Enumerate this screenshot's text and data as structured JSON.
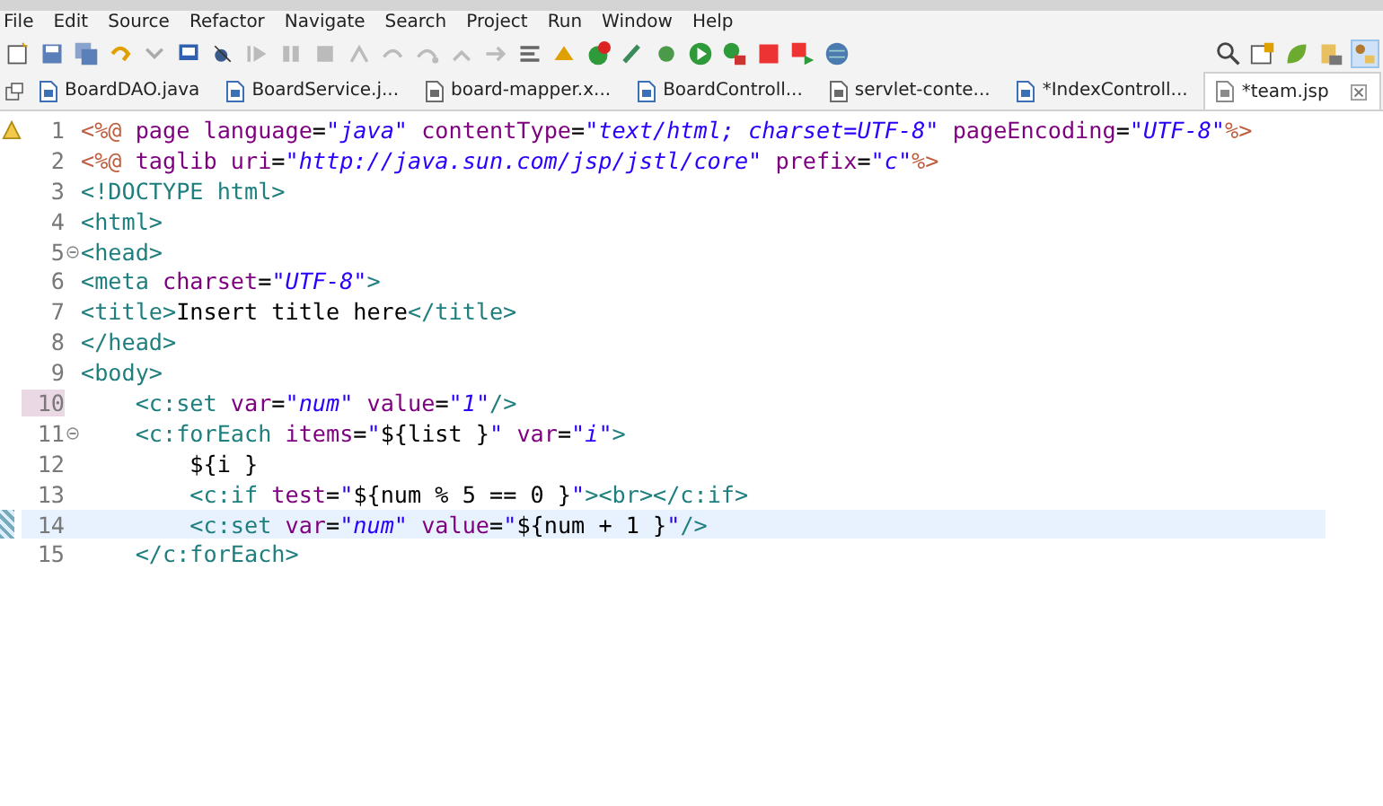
{
  "menu": [
    "File",
    "Edit",
    "Source",
    "Refactor",
    "Navigate",
    "Search",
    "Project",
    "Run",
    "Window",
    "Help"
  ],
  "tabs": [
    {
      "label": "BoardDAO.java",
      "kind": "java",
      "selected": false
    },
    {
      "label": "BoardService.j...",
      "kind": "java",
      "selected": false
    },
    {
      "label": "board-mapper.x...",
      "kind": "xml",
      "selected": false
    },
    {
      "label": "BoardControll...",
      "kind": "java",
      "selected": false
    },
    {
      "label": "servlet-conte...",
      "kind": "xml",
      "selected": false
    },
    {
      "label": "*IndexControll...",
      "kind": "java",
      "selected": false
    },
    {
      "label": "*team.jsp",
      "kind": "jsp",
      "selected": true
    }
  ],
  "lines": [
    {
      "number": "1",
      "marked": false,
      "current": false,
      "foldable": false,
      "tokens": [
        {
          "kind": "dir",
          "text": "<%@"
        },
        {
          "kind": "attr",
          "text": " page language"
        },
        {
          "kind": "eq",
          "text": "="
        },
        {
          "kind": "str",
          "text": "\"java\""
        },
        {
          "kind": "attr",
          "text": " contentType"
        },
        {
          "kind": "eq",
          "text": "="
        },
        {
          "kind": "str",
          "text": "\"text/html; charset=UTF-8\""
        },
        {
          "kind": "attr",
          "text": " pageEncoding"
        },
        {
          "kind": "eq",
          "text": "="
        },
        {
          "kind": "str",
          "text": "\"UTF-8\""
        },
        {
          "kind": "dir",
          "text": "%>"
        }
      ]
    },
    {
      "number": "2",
      "marked": false,
      "current": false,
      "foldable": false,
      "tokens": [
        {
          "kind": "dir",
          "text": "<%@"
        },
        {
          "kind": "attr",
          "text": " taglib uri"
        },
        {
          "kind": "eq",
          "text": "="
        },
        {
          "kind": "str",
          "text": "\"http://java.sun.com/jsp/jstl/core\""
        },
        {
          "kind": "attr",
          "text": " prefix"
        },
        {
          "kind": "eq",
          "text": "="
        },
        {
          "kind": "str",
          "text": "\"c\""
        },
        {
          "kind": "dir",
          "text": "%>"
        }
      ]
    },
    {
      "number": "3",
      "marked": false,
      "current": false,
      "foldable": false,
      "tokens": [
        {
          "kind": "tag",
          "text": "<!DOCTYPE html>"
        }
      ]
    },
    {
      "number": "4",
      "marked": false,
      "current": false,
      "foldable": false,
      "tokens": [
        {
          "kind": "tag",
          "text": "<html>"
        }
      ]
    },
    {
      "number": "5",
      "marked": false,
      "current": false,
      "foldable": true,
      "tokens": [
        {
          "kind": "tag",
          "text": "<head>"
        }
      ]
    },
    {
      "number": "6",
      "marked": false,
      "current": false,
      "foldable": false,
      "tokens": [
        {
          "kind": "tag",
          "text": "<meta"
        },
        {
          "kind": "attr",
          "text": " charset"
        },
        {
          "kind": "eq",
          "text": "="
        },
        {
          "kind": "str",
          "text": "\"UTF-8\""
        },
        {
          "kind": "tag",
          "text": ">"
        }
      ]
    },
    {
      "number": "7",
      "marked": false,
      "current": false,
      "foldable": false,
      "tokens": [
        {
          "kind": "tag",
          "text": "<title>"
        },
        {
          "kind": "text",
          "text": "Insert title here"
        },
        {
          "kind": "tag",
          "text": "</title>"
        }
      ]
    },
    {
      "number": "8",
      "marked": false,
      "current": false,
      "foldable": false,
      "tokens": [
        {
          "kind": "tag",
          "text": "</head>"
        }
      ]
    },
    {
      "number": "9",
      "marked": false,
      "current": false,
      "foldable": false,
      "tokens": [
        {
          "kind": "tag",
          "text": "<body>"
        }
      ],
      "children": [
        {
          "number": "10",
          "marked": true,
          "current": false,
          "foldable": false,
          "tokens": [
            {
              "kind": "tag",
              "text": "<c:set"
            },
            {
              "kind": "attr",
              "text": " var"
            },
            {
              "kind": "eq",
              "text": "="
            },
            {
              "kind": "str",
              "text": "\"num\""
            },
            {
              "kind": "attr",
              "text": " value"
            },
            {
              "kind": "eq",
              "text": "="
            },
            {
              "kind": "str",
              "text": "\"1\""
            },
            {
              "kind": "tag",
              "text": "/>"
            }
          ]
        },
        {
          "number": "11",
          "marked": false,
          "current": false,
          "foldable": true,
          "tokens": [
            {
              "kind": "tag",
              "text": "<c:forEach"
            },
            {
              "kind": "attr",
              "text": " items"
            },
            {
              "kind": "eq",
              "text": "="
            },
            {
              "kind": "str",
              "text": "\""
            },
            {
              "kind": "text",
              "text": "${list }"
            },
            {
              "kind": "str",
              "text": "\""
            },
            {
              "kind": "attr",
              "text": " var"
            },
            {
              "kind": "eq",
              "text": "="
            },
            {
              "kind": "str",
              "text": "\"i\""
            },
            {
              "kind": "tag",
              "text": ">"
            }
          ],
          "children": [
            {
              "number": "12",
              "marked": false,
              "current": false,
              "foldable": false,
              "tokens": [
                {
                  "kind": "text",
                  "text": "${i }"
                }
              ]
            },
            {
              "number": "13",
              "marked": false,
              "current": false,
              "foldable": false,
              "tokens": [
                {
                  "kind": "tag",
                  "text": "<c:if"
                },
                {
                  "kind": "attr",
                  "text": " test"
                },
                {
                  "kind": "eq",
                  "text": "="
                },
                {
                  "kind": "str",
                  "text": "\""
                },
                {
                  "kind": "text",
                  "text": "${num % 5 == 0 }"
                },
                {
                  "kind": "str",
                  "text": "\""
                },
                {
                  "kind": "tag",
                  "text": "><br></c:if>"
                }
              ]
            },
            {
              "number": "14",
              "marked": false,
              "current": true,
              "foldable": false,
              "tokens": [
                {
                  "kind": "tag",
                  "text": "<c:set"
                },
                {
                  "kind": "attr",
                  "text": " var"
                },
                {
                  "kind": "eq",
                  "text": "="
                },
                {
                  "kind": "str",
                  "text": "\"num\""
                },
                {
                  "kind": "attr",
                  "text": " value"
                },
                {
                  "kind": "eq",
                  "text": "="
                },
                {
                  "kind": "str",
                  "text": "\""
                },
                {
                  "kind": "text",
                  "text": "${num + 1 }"
                },
                {
                  "kind": "str",
                  "text": "\""
                },
                {
                  "kind": "tag",
                  "text": "/>"
                }
              ]
            }
          ]
        },
        {
          "number": "15",
          "marked": false,
          "current": false,
          "foldable": false,
          "tokens": [
            {
              "kind": "tag",
              "text": "</c:forEach>"
            }
          ]
        }
      ]
    }
  ]
}
